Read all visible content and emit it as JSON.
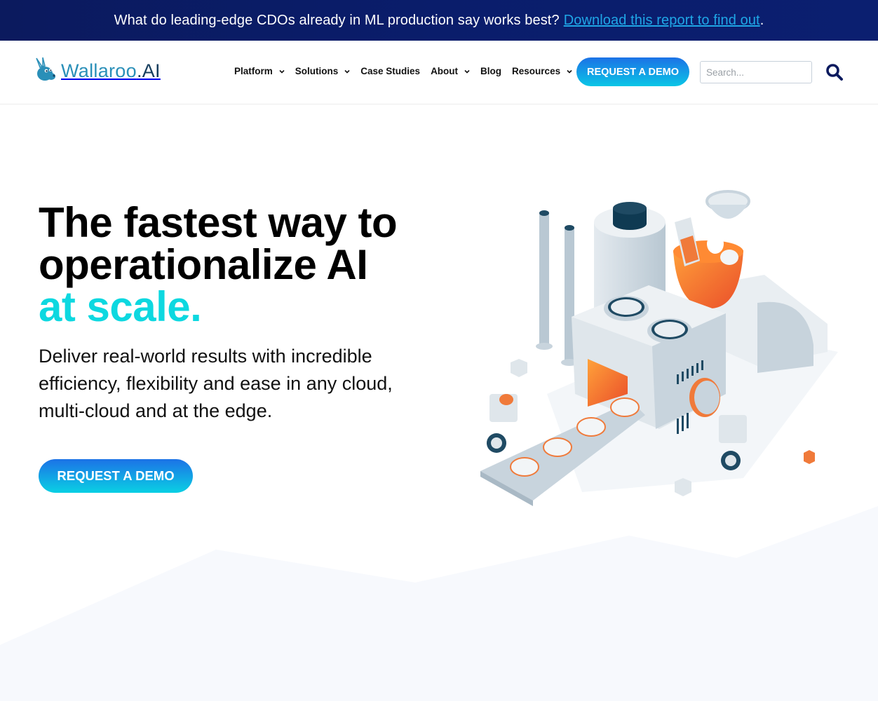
{
  "banner": {
    "text": "What do leading-edge CDOs already in ML production say works best?",
    "link_text": "Download this report to find out",
    "trailing": "."
  },
  "header": {
    "logo": {
      "brand": "Wallaroo",
      "suffix": ".AI",
      "icon": "kangaroo-logo-icon"
    },
    "nav": [
      {
        "label": "Platform",
        "has_dropdown": true
      },
      {
        "label": "Solutions",
        "has_dropdown": true
      },
      {
        "label": "Case Studies",
        "has_dropdown": false
      },
      {
        "label": "About",
        "has_dropdown": true
      },
      {
        "label": "Blog",
        "has_dropdown": false
      },
      {
        "label": "Resources",
        "has_dropdown": true
      }
    ],
    "cta_label": "REQUEST A DEMO",
    "search": {
      "placeholder": "Search...",
      "value": "",
      "icon": "search-icon"
    }
  },
  "hero": {
    "title_line1": "The fastest way to",
    "title_line2": "operationalize AI",
    "title_accent": "at scale.",
    "subtitle": "Deliver real-world results with incredible efficiency, flexibility and ease in any cloud, multi-cloud and at the edge.",
    "cta_label": "REQUEST A DEMO",
    "illustration": "isometric-factory-illustration"
  },
  "colors": {
    "banner_bg": "#0b1a5e",
    "banner_link": "#1fa6e6",
    "accent_cyan": "#0dd8e0",
    "button_gradient_top": "#1c72e6",
    "button_gradient_bottom": "#0ac6e6",
    "logo_blue": "#2a8fb8",
    "logo_dark": "#173e5e",
    "search_icon": "#0b1a5e",
    "illustration_orange": "#f7762b"
  }
}
